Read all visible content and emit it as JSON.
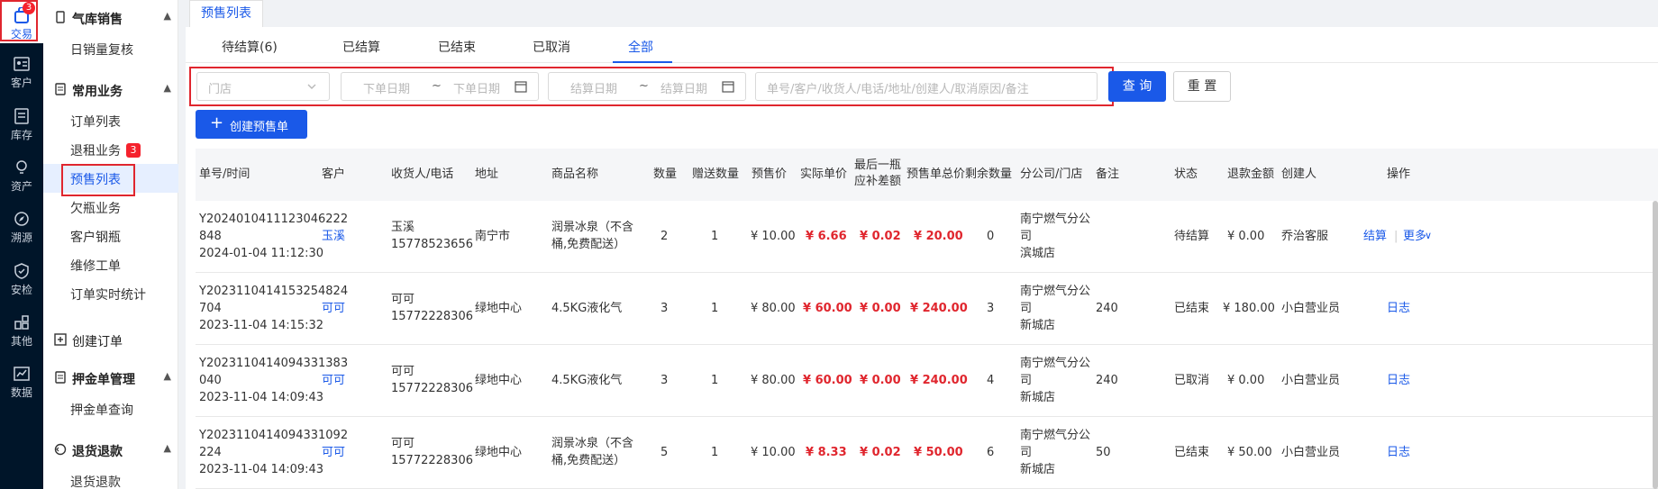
{
  "rail": {
    "items": [
      {
        "label": "交易",
        "icon": "bag-icon",
        "badge": "3",
        "active": true
      },
      {
        "label": "客户",
        "icon": "contact-card-icon"
      },
      {
        "label": "库存",
        "icon": "inventory-icon"
      },
      {
        "label": "资产",
        "icon": "bulb-icon"
      },
      {
        "label": "溯源",
        "icon": "compass-icon"
      },
      {
        "label": "安检",
        "icon": "shield-icon"
      },
      {
        "label": "其他",
        "icon": "apps-icon"
      },
      {
        "label": "数据",
        "icon": "chart-icon"
      }
    ]
  },
  "submenu": {
    "groups": [
      {
        "label": "气库销售",
        "items": [
          "日销量复核"
        ]
      },
      {
        "label": "常用业务",
        "items": [
          "订单列表",
          "退租业务",
          "预售列表",
          "欠瓶业务",
          "客户钢瓶",
          "维修工单",
          "订单实时统计"
        ]
      },
      {
        "label": "创建订单",
        "items": []
      },
      {
        "label": "押金单管理",
        "items": [
          "押金单查询"
        ]
      },
      {
        "label": "退货退款",
        "items": [
          "退货退款"
        ]
      }
    ],
    "badge_tuizu": "3",
    "active": "预售列表"
  },
  "page_tab": "预售列表",
  "status_tabs": [
    "待结算(6)",
    "已结算",
    "已结束",
    "已取消",
    "全部"
  ],
  "active_status_tab": "全部",
  "filters": {
    "store_placeholder": "门店",
    "order_date_start": "下单日期",
    "order_date_end": "下单日期",
    "settle_date_start": "结算日期",
    "settle_date_end": "结算日期",
    "range_sep": "~",
    "keyword_placeholder": "单号/客户/收货人/电话/地址/创建人/取消原因/备注",
    "search_btn": "查 询",
    "reset_btn": "重 置"
  },
  "create_btn": "创建预售单",
  "table": {
    "headers": [
      "单号/时间",
      "客户",
      "收货人/电话",
      "地址",
      "商品名称",
      "数量",
      "赠送数量",
      "预售价",
      "实际单价",
      "最后一瓶应补差额",
      "预售单总价",
      "剩余数量",
      "分公司/门店",
      "备注",
      "状态",
      "退款金额",
      "创建人",
      "操作"
    ],
    "rows": [
      {
        "order_no_1": "Y2024010411123046222",
        "order_no_2": "848",
        "time": "2024-01-04 11:12:30",
        "customer": "玉溪",
        "receiver": "玉溪",
        "phone": "15778523656",
        "address": "南宁市",
        "product_1": "润景冰泉（不含",
        "product_2": "桶,免费配送）",
        "qty": "2",
        "gift_qty": "1",
        "presale_price": "¥ 10.00",
        "unit_price": "¥ 6.66",
        "diff": "¥ 0.02",
        "total": "¥ 20.00",
        "remain": "0",
        "branch_1": "南宁燃气分公",
        "branch_2": "司",
        "branch_3": "滨城店",
        "remark": "",
        "status": "待结算",
        "refund": "¥ 0.00",
        "creator": "乔治客服",
        "actions": [
          "结算",
          "更多"
        ]
      },
      {
        "order_no_1": "Y2023110414153254824",
        "order_no_2": "704",
        "time": "2023-11-04 14:15:32",
        "customer": "可可",
        "receiver": "可可",
        "phone": "15772228306",
        "address": "绿地中心",
        "product_1": "4.5KG液化气",
        "product_2": "",
        "qty": "3",
        "gift_qty": "1",
        "presale_price": "¥ 80.00",
        "unit_price": "¥ 60.00",
        "diff": "¥ 0.00",
        "total": "¥ 240.00",
        "remain": "3",
        "branch_1": "南宁燃气分公",
        "branch_2": "司",
        "branch_3": "新城店",
        "remark": "240",
        "status": "已结束",
        "refund": "¥ 180.00",
        "creator": "小白营业员",
        "actions": [
          "日志"
        ]
      },
      {
        "order_no_1": "Y2023110414094331383",
        "order_no_2": "040",
        "time": "2023-11-04 14:09:43",
        "customer": "可可",
        "receiver": "可可",
        "phone": "15772228306",
        "address": "绿地中心",
        "product_1": "4.5KG液化气",
        "product_2": "",
        "qty": "3",
        "gift_qty": "1",
        "presale_price": "¥ 80.00",
        "unit_price": "¥ 60.00",
        "diff": "¥ 0.00",
        "total": "¥ 240.00",
        "remain": "4",
        "branch_1": "南宁燃气分公",
        "branch_2": "司",
        "branch_3": "新城店",
        "remark": "240",
        "status": "已取消",
        "refund": "¥ 0.00",
        "creator": "小白营业员",
        "actions": [
          "日志"
        ]
      },
      {
        "order_no_1": "Y2023110414094331092",
        "order_no_2": "224",
        "time": "2023-11-04 14:09:43",
        "customer": "可可",
        "receiver": "可可",
        "phone": "15772228306",
        "address": "绿地中心",
        "product_1": "润景冰泉（不含",
        "product_2": "桶,免费配送）",
        "qty": "5",
        "gift_qty": "1",
        "presale_price": "¥ 10.00",
        "unit_price": "¥ 8.33",
        "diff": "¥ 0.02",
        "total": "¥ 50.00",
        "remain": "6",
        "branch_1": "南宁燃气分公",
        "branch_2": "司",
        "branch_3": "新城店",
        "remark": "50",
        "status": "已结束",
        "refund": "¥ 50.00",
        "creator": "小白营业员",
        "actions": [
          "日志"
        ]
      }
    ]
  }
}
